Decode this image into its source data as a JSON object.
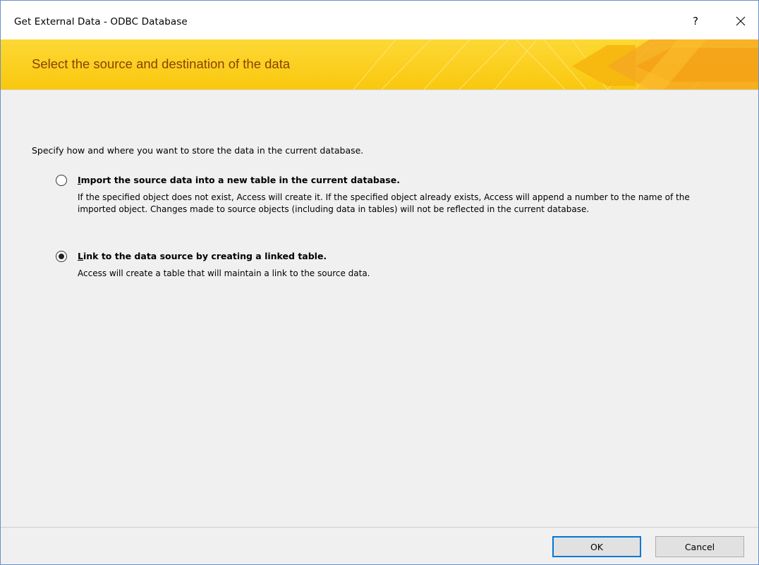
{
  "window": {
    "title": "Get External Data - ODBC Database",
    "help_label": "?",
    "close_icon": "close-icon"
  },
  "banner": {
    "title": "Select the source and destination of the data",
    "colors": {
      "background": "#fcd218",
      "title_text": "#8a4200",
      "accent": "#f39c12"
    }
  },
  "main": {
    "instruction": "Specify how and where you want to store the data in the current database.",
    "options": [
      {
        "mnemonic": "I",
        "label_rest": "mport the source data into a new table in the current database.",
        "description": "If the specified object does not exist, Access will create it. If the specified object already exists, Access will append a number to the name of the imported object. Changes made to source objects (including data in tables) will not be reflected in the current database.",
        "selected": false
      },
      {
        "mnemonic": "L",
        "label_rest": "ink to the data source by creating a linked table.",
        "description": "Access will create a table that will maintain a link to the source data.",
        "selected": true
      }
    ]
  },
  "footer": {
    "ok_label": "OK",
    "cancel_label": "Cancel",
    "default_accent": "#0078d7"
  }
}
